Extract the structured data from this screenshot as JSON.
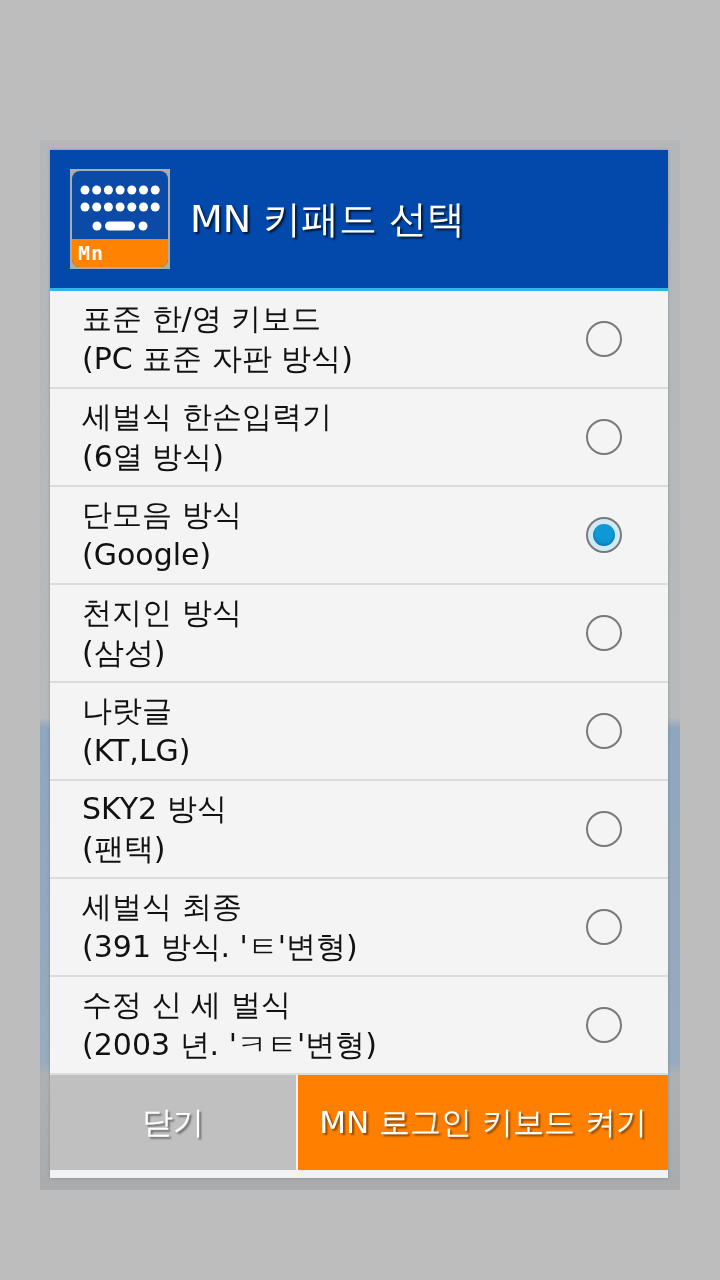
{
  "dialog": {
    "title": "MN 키패드 선택",
    "logo_text": "Mn"
  },
  "options": [
    {
      "title": "표준 한/영 키보드",
      "subtitle": "(PC 표준 자판 방식)",
      "selected": false
    },
    {
      "title": "세벌식 한손입력기",
      "subtitle": "(6열 방식)",
      "selected": false
    },
    {
      "title": "단모음 방식",
      "subtitle": "(Google)",
      "selected": true
    },
    {
      "title": "천지인 방식",
      "subtitle": "(삼성)",
      "selected": false
    },
    {
      "title": "나랏글",
      "subtitle": "(KT,LG)",
      "selected": false
    },
    {
      "title": "SKY2 방식",
      "subtitle": "(팬택)",
      "selected": false
    },
    {
      "title": "세벌식 최종",
      "subtitle": "(391 방식. 'ㅌ'변형)",
      "selected": false
    },
    {
      "title": "수정 신 세 벌식",
      "subtitle": "(2003 년. 'ㅋㅌ'변형)",
      "selected": false
    }
  ],
  "buttons": [
    {
      "label": "닫기",
      "kind": "secondary"
    },
    {
      "label": "MN 로그인 키보드 켜기",
      "kind": "primary"
    }
  ]
}
